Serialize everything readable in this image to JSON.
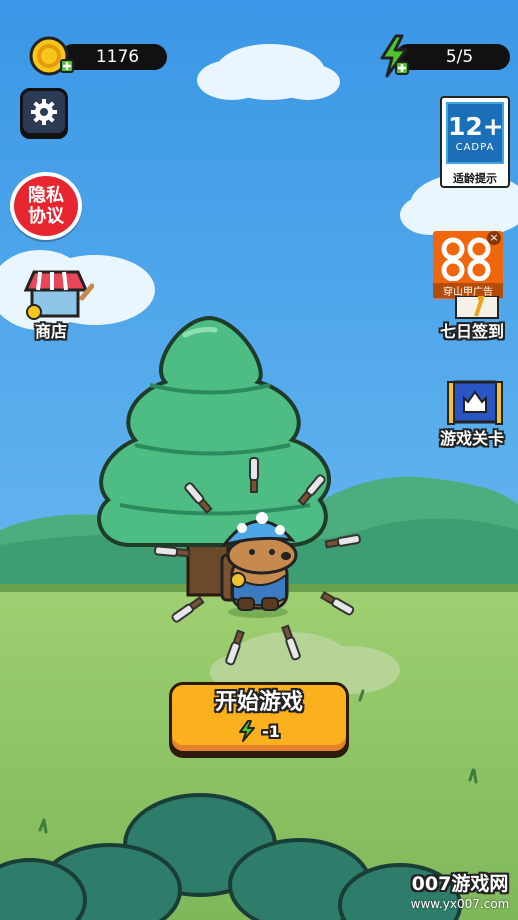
{
  "hud": {
    "coins": "1176",
    "energy": "5/5"
  },
  "buttons": {
    "privacy_line1": "隐私",
    "privacy_line2": "协议",
    "shop_label": "商店",
    "checkin_label": "七日签到",
    "levels_label": "游戏关卡",
    "start_label": "开始游戏",
    "start_cost": "-1"
  },
  "age_rating": {
    "value": "12+",
    "org": "CADPA",
    "caption": "适龄提示"
  },
  "ad": {
    "label": "穿山甲广告",
    "close": "×"
  },
  "watermark": {
    "brand": "007游戏网",
    "url": "www.yx007.com"
  },
  "colors": {
    "sky": "#3f9be8",
    "grass": "#8fc36b",
    "tree": "#4dbd83",
    "start_button": "#fbb01d",
    "privacy_button": "#e8262f",
    "energy": "#4fc42a",
    "coin": "#f7c61a"
  },
  "icons": [
    "coin-icon",
    "energy-icon",
    "gear-icon",
    "shop-stall-icon",
    "calendar-icon",
    "castle-banner-icon",
    "lightning-icon"
  ]
}
